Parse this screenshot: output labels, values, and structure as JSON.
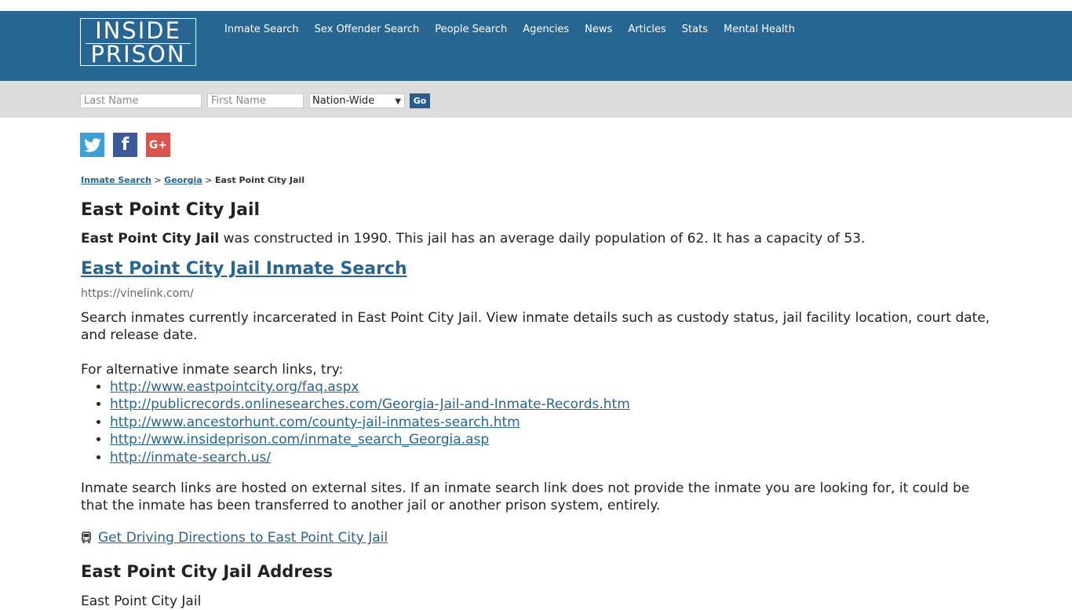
{
  "logo": {
    "line1": "INSIDE",
    "line2": "PRISON"
  },
  "nav": [
    {
      "label": "Inmate Search"
    },
    {
      "label": "Sex Offender Search"
    },
    {
      "label": "People Search"
    },
    {
      "label": "Agencies"
    },
    {
      "label": "News"
    },
    {
      "label": "Articles"
    },
    {
      "label": "Stats"
    },
    {
      "label": "Mental Health"
    }
  ],
  "search": {
    "last_placeholder": "Last Name",
    "first_placeholder": "First Name",
    "region_selected": "Nation-Wide",
    "go_label": "Go"
  },
  "social": {
    "twitter": "twitter-icon",
    "facebook": "facebook-icon",
    "google": "google-plus-icon",
    "fb_glyph": "f",
    "gp_glyph": "G+"
  },
  "breadcrumb": {
    "root": "Inmate Search",
    "sep1": ">",
    "state": "Georgia",
    "sep2": ">",
    "current": "East Point City Jail"
  },
  "page": {
    "title": "East Point City Jail",
    "intro_name": "East Point City Jail",
    "intro_rest": " was constructed in 1990. This jail has an average daily population of 62. It has a capacity of 53.",
    "search_link": "East Point City Jail Inmate Search",
    "search_url": "https://vinelink.com/",
    "description": "Search inmates currently incarcerated in East Point City Jail. View inmate details such as custody status, jail facility location, court date, and release date.",
    "alt_intro": "For alternative inmate search links, try:",
    "alt_links": [
      "http://www.eastpointcity.org/faq.aspx",
      "http://publicrecords.onlinesearches.com/Georgia-Jail-and-Inmate-Records.htm",
      "http://www.ancestorhunt.com/county-jail-inmates-search.htm",
      "http://www.insideprison.com/inmate_search_Georgia.asp",
      "http://inmate-search.us/"
    ],
    "note": "Inmate search links are hosted on external sites. If an inmate search link does not provide the inmate you are looking for, it could be that the inmate has been transferred to another jail or another prison system, entirely.",
    "directions": "Get Driving Directions to East Point City Jail",
    "address_heading": "East Point City Jail Address",
    "address_line1": "East Point City Jail"
  },
  "colors": {
    "header": "#276592",
    "searchbar": "#dddddd",
    "link": "#276592",
    "go": "#2a5d8f"
  }
}
